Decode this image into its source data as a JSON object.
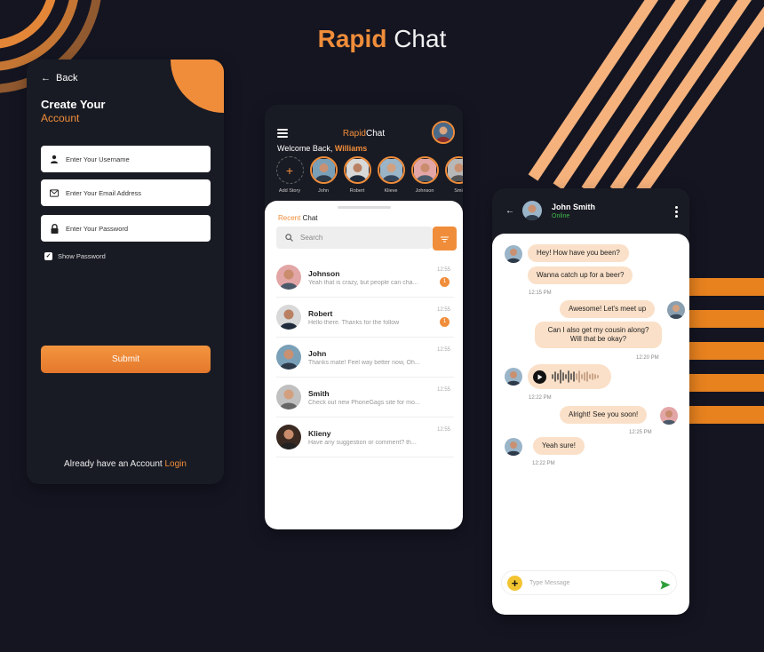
{
  "title": {
    "part1": "Rapid",
    "part2": "Chat"
  },
  "colors": {
    "accent": "#f08d3a",
    "background": "#141521",
    "online": "#3dbb4a"
  },
  "signup": {
    "back_label": "Back",
    "heading_line1": "Create Your",
    "heading_line2": "Account",
    "username_placeholder": "Enter Your Username",
    "email_placeholder": "Enter Your Email Address",
    "password_placeholder": "Enter Your Password",
    "show_password_label": "Show Password",
    "show_password_checked": true,
    "submit_label": "Submit",
    "already_text": "Already have an Account",
    "login_link": "Login"
  },
  "chatlist": {
    "brand_part1": "Rapid",
    "brand_part2": "Chat",
    "welcome_text": "Welcome Back,",
    "welcome_name": "Williams",
    "stories": [
      {
        "label": "Add Story",
        "icon": "plus-icon"
      },
      {
        "label": "John"
      },
      {
        "label": "Robert"
      },
      {
        "label": "Klieve"
      },
      {
        "label": "Johnson"
      },
      {
        "label": "Smi"
      }
    ],
    "recent_part1": "Recent",
    "recent_part2": "Chat",
    "search_placeholder": "Search",
    "chats": [
      {
        "name": "Johnson",
        "message": "Yeah that is crazy, but people can cha...",
        "time": "12:55",
        "badge": "1"
      },
      {
        "name": "Robert",
        "message": "Hello there. Thanks for the follow",
        "time": "12:55",
        "badge": "1"
      },
      {
        "name": "John",
        "message": "Thanks mate! Feel way better now, Oh...",
        "time": "12:55"
      },
      {
        "name": "Smith",
        "message": "Check out new PhoneGags site for mo...",
        "time": "12:55"
      },
      {
        "name": "Klieny",
        "message": "Have any suggestion or comment? th...",
        "time": "12:55"
      }
    ]
  },
  "conversation": {
    "contact_name": "John Smith",
    "contact_status": "Online",
    "messages": {
      "m1": "Hey! How have you been?",
      "m2": "Wanna catch up for a beer?",
      "t1": "12:15 PM",
      "m3": "Awesome! Let's meet up",
      "m4": "Can I also get my cousin along? Will that be okay?",
      "t2": "12:20 PM",
      "t3": "12:22 PM",
      "m5": "Alright! See you soon!",
      "t4": "12:25 PM",
      "m6": "Yeah sure!",
      "t5": "12:22 PM"
    },
    "input_placeholder": "Type Message"
  }
}
